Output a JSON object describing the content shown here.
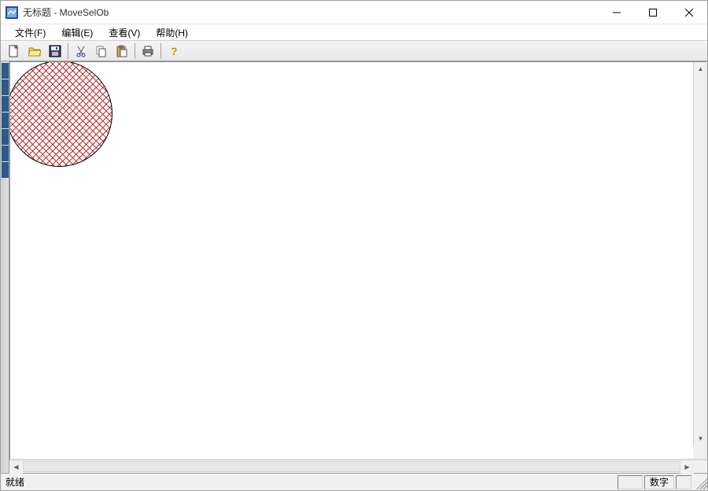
{
  "title": "无标题 - MoveSelOb",
  "menu": {
    "file": "文件(F)",
    "edit": "编辑(E)",
    "view": "查看(V)",
    "help": "帮助(H)"
  },
  "toolbar": {
    "new": "new-icon",
    "open": "open-icon",
    "save": "save-icon",
    "cut": "cut-icon",
    "copy": "copy-icon",
    "paste": "paste-icon",
    "print": "print-icon",
    "help": "help-icon"
  },
  "status": {
    "ready": "就绪",
    "numlock": "数字"
  },
  "canvas": {
    "shape": {
      "type": "circle",
      "fill_pattern": "diagonal-hatch",
      "color": "#b33333"
    }
  }
}
